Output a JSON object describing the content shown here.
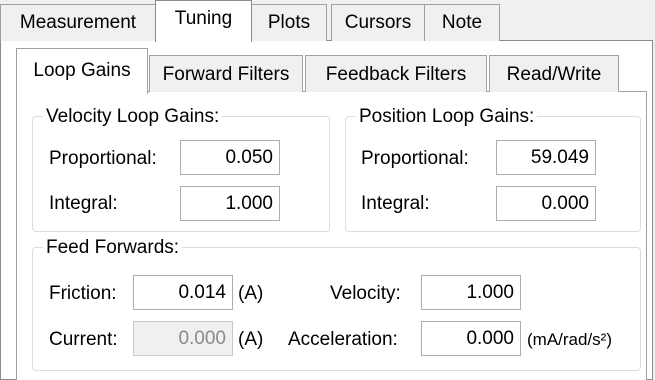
{
  "outer_tabs": [
    {
      "label": "Measurement"
    },
    {
      "label": "Tuning"
    },
    {
      "label": "Plots"
    },
    {
      "label": "Cursors"
    },
    {
      "label": "Note"
    }
  ],
  "inner_tabs": [
    {
      "label": "Loop Gains"
    },
    {
      "label": "Forward Filters"
    },
    {
      "label": "Feedback Filters"
    },
    {
      "label": "Read/Write"
    }
  ],
  "velocity_gains": {
    "legend": "Velocity Loop Gains:",
    "proportional_label": "Proportional:",
    "proportional_value": "0.050",
    "integral_label": "Integral:",
    "integral_value": "1.000"
  },
  "position_gains": {
    "legend": "Position Loop Gains:",
    "proportional_label": "Proportional:",
    "proportional_value": "59.049",
    "integral_label": "Integral:",
    "integral_value": "0.000"
  },
  "feed_forwards": {
    "legend": "Feed Forwards:",
    "friction_label": "Friction:",
    "friction_value": "0.014",
    "friction_unit": "(A)",
    "current_label": "Current:",
    "current_value": "0.000",
    "current_unit": "(A)",
    "velocity_label": "Velocity:",
    "velocity_value": "1.000",
    "acceleration_label": "Acceleration:",
    "acceleration_value": "0.000",
    "acceleration_unit": "(mA/rad/s²)"
  }
}
